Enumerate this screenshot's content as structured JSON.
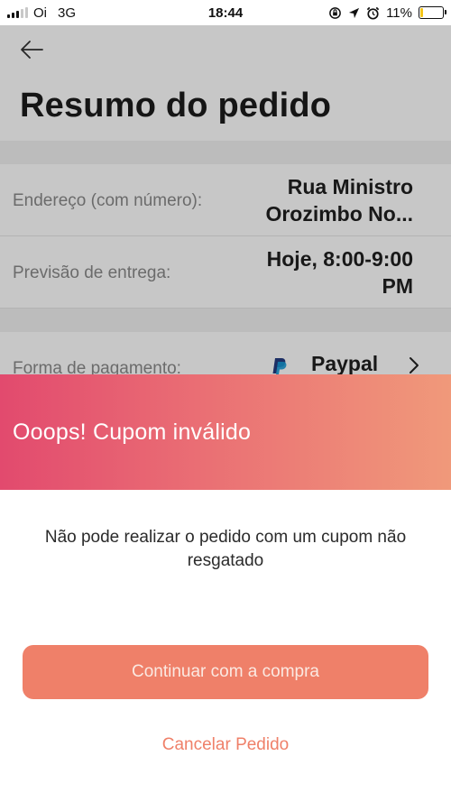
{
  "status_bar": {
    "carrier": "Oi",
    "network": "3G",
    "time": "18:44",
    "battery_percent": "11%",
    "battery_level": 0.11,
    "battery_color": "#f5c518",
    "icons": [
      "signal-bars-icon",
      "screen-lock-rotation-icon",
      "location-arrow-icon",
      "alarm-clock-icon",
      "battery-icon"
    ]
  },
  "header": {
    "back_icon": "arrow-left-icon",
    "title": "Resumo do pedido"
  },
  "summary": {
    "address_label": "Endereço (com número):",
    "address_value_line1": "Rua Ministro",
    "address_value_line2": "Orozimbo No...",
    "delivery_label": "Previsão de entrega:",
    "delivery_value_line1": "Hoje, 8:00-9:00",
    "delivery_value_line2": "PM",
    "payment_label": "Forma de pagamento:",
    "payment_value": "Paypal",
    "payment_icon": "paypal-icon",
    "payment_chevron": "chevron-right-icon"
  },
  "modal": {
    "title": "Ooops! Cupom inválido",
    "message": "Não pode realizar o pedido com um cupom não resgatado",
    "primary_button": "Continuar com a compra",
    "secondary_link": "Cancelar Pedido",
    "gradient_start": "#e24a6e",
    "gradient_end": "#f0997a",
    "accent": "#ef8069"
  }
}
